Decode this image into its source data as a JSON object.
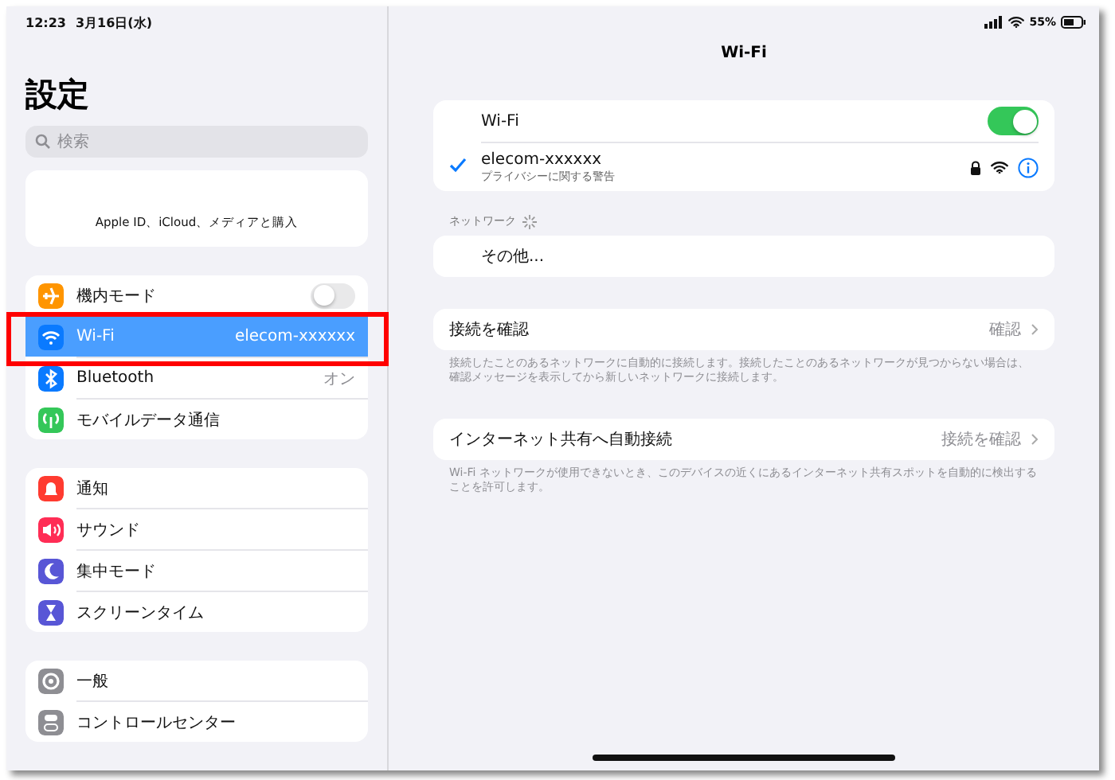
{
  "status_bar": {
    "time": "12:23",
    "date": "3月16日(水)",
    "battery": "55%"
  },
  "sidebar": {
    "title": "設定",
    "search": {
      "placeholder": "検索"
    },
    "account_label": "Apple ID、iCloud、メディアと購入",
    "groups": [
      [
        {
          "kind": "toggle",
          "label": "機内モード",
          "on": false,
          "selected": false,
          "color": "#ff9500"
        },
        {
          "kind": "value",
          "label": "Wi-Fi",
          "value": "elecom-xxxxxx",
          "selected": true,
          "color": "#0a7aff"
        },
        {
          "kind": "value",
          "label": "Bluetooth",
          "value": "オン",
          "selected": false,
          "color": "#0a7aff"
        },
        {
          "kind": "link",
          "label": "モバイルデータ通信",
          "selected": false,
          "color": "#34c759"
        }
      ],
      [
        {
          "kind": "link",
          "label": "通知",
          "selected": false,
          "color": "#ff3b30"
        },
        {
          "kind": "link",
          "label": "サウンド",
          "selected": false,
          "color": "#ff2d55"
        },
        {
          "kind": "link",
          "label": "集中モード",
          "selected": false,
          "color": "#5856d6"
        },
        {
          "kind": "link",
          "label": "スクリーンタイム",
          "selected": false,
          "color": "#5856d6"
        }
      ],
      [
        {
          "kind": "link",
          "label": "一般",
          "selected": false,
          "color": "#8e8e93"
        },
        {
          "kind": "link",
          "label": "コントロールセンター",
          "selected": false,
          "color": "#8e8e93"
        }
      ]
    ]
  },
  "detail": {
    "title": "Wi-Fi",
    "wifi": {
      "label": "Wi-Fi",
      "on": true
    },
    "current_network": {
      "name": "elecom-xxxxxx",
      "subtitle": "プライバシーに関する警告",
      "selected": true
    },
    "networks_header": "ネットワーク",
    "other_label": "その他...",
    "settings": [
      {
        "label": "接続を確認",
        "value": "確認",
        "note": "接続したことのあるネットワークに自動的に接続します。接続したことのあるネットワークが見つからない場合は、確認メッセージを表示してから新しいネットワークに接続します。"
      },
      {
        "label": "インターネット共有へ自動接続",
        "value": "接続を確認",
        "note": "Wi-Fi ネットワークが使用できないとき、このデバイスの近くにあるインターネット共有スポットを自動的に検出することを許可します。"
      }
    ]
  }
}
